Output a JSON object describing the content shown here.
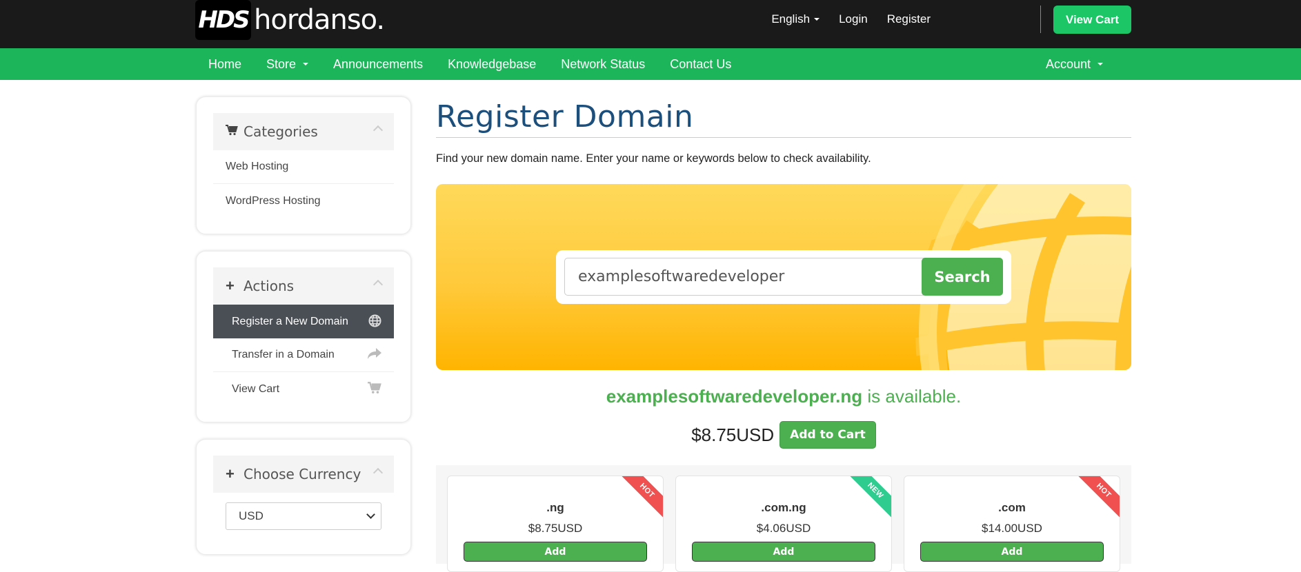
{
  "brand": {
    "logo_mark": "HDS",
    "name": "hordanso."
  },
  "topbar": {
    "language": "English",
    "login": "Login",
    "register": "Register",
    "view_cart": "View Cart"
  },
  "nav": {
    "items": [
      "Home",
      "Store",
      "Announcements",
      "Knowledgebase",
      "Network Status",
      "Contact Us"
    ],
    "account": "Account"
  },
  "sidebar": {
    "categories": {
      "title": "Categories",
      "items": [
        "Web Hosting",
        "WordPress Hosting"
      ]
    },
    "actions": {
      "title": "Actions",
      "items": [
        "Register a New Domain",
        "Transfer in a Domain",
        "View Cart"
      ]
    },
    "currency": {
      "title": "Choose Currency",
      "selected": "USD"
    }
  },
  "main": {
    "title": "Register Domain",
    "intro": "Find your new domain name. Enter your name or keywords below to check availability.",
    "search_value": "examplesoftwaredeveloper",
    "search_button": "Search",
    "result_domain": "examplesoftwaredeveloper.ng",
    "result_status": " is available.",
    "result_price": "$8.75USD",
    "add_to_cart": "Add to Cart"
  },
  "tlds": [
    {
      "name": ".ng",
      "price": "$8.75USD",
      "button": "Add",
      "badge": "HOT",
      "badge_color": "#f0504f"
    },
    {
      "name": ".com.ng",
      "price": "$4.06USD",
      "button": "Add",
      "badge": "NEW",
      "badge_color": "#2ecc8f"
    },
    {
      "name": ".com",
      "price": "$14.00USD",
      "button": "Add",
      "badge": "HOT",
      "badge_color": "#f0504f"
    }
  ],
  "colors": {
    "green": "#1cb55a",
    "accent_green": "#4caf50",
    "title_blue": "#1d4f7c",
    "topbar": "#1a1a1a"
  }
}
